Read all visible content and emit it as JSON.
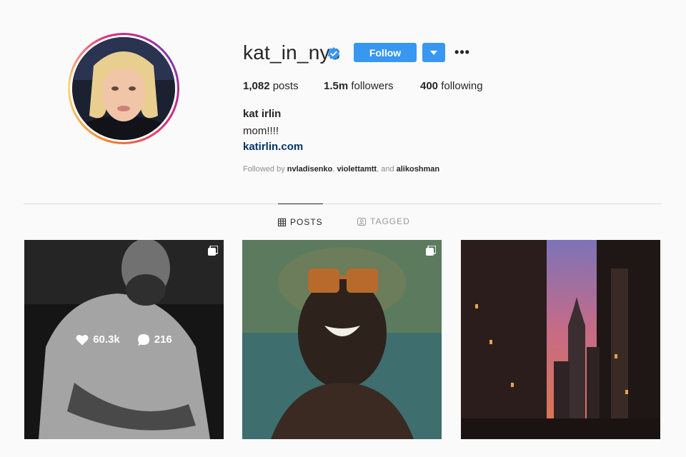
{
  "profile": {
    "username": "kat_in_nyc",
    "verified_icon": "verified-badge-icon",
    "follow_label": "Follow",
    "more_label": "•••",
    "stats": {
      "posts_count": "1,082",
      "posts_label": "posts",
      "followers_count": "1.5m",
      "followers_label": "followers",
      "following_count": "400",
      "following_label": "following"
    },
    "full_name": "kat irlin",
    "bio": "mom!!!!",
    "website": "katirlin.com",
    "followed_by": {
      "prefix": "Followed by",
      "user1": "nvladisenko",
      "sep1": ",",
      "user2": "violettamtt",
      "sep2": ", and",
      "user3": "alikoshman"
    }
  },
  "tabs": {
    "posts": "POSTS",
    "tagged": "TAGGED"
  },
  "posts": [
    {
      "likes": "60.3k",
      "comments": "216",
      "multi": true
    },
    {
      "multi": true
    },
    {
      "multi": false
    }
  ],
  "colors": {
    "accent": "#3897f0",
    "link": "#003569",
    "muted": "#8e8e8e"
  }
}
